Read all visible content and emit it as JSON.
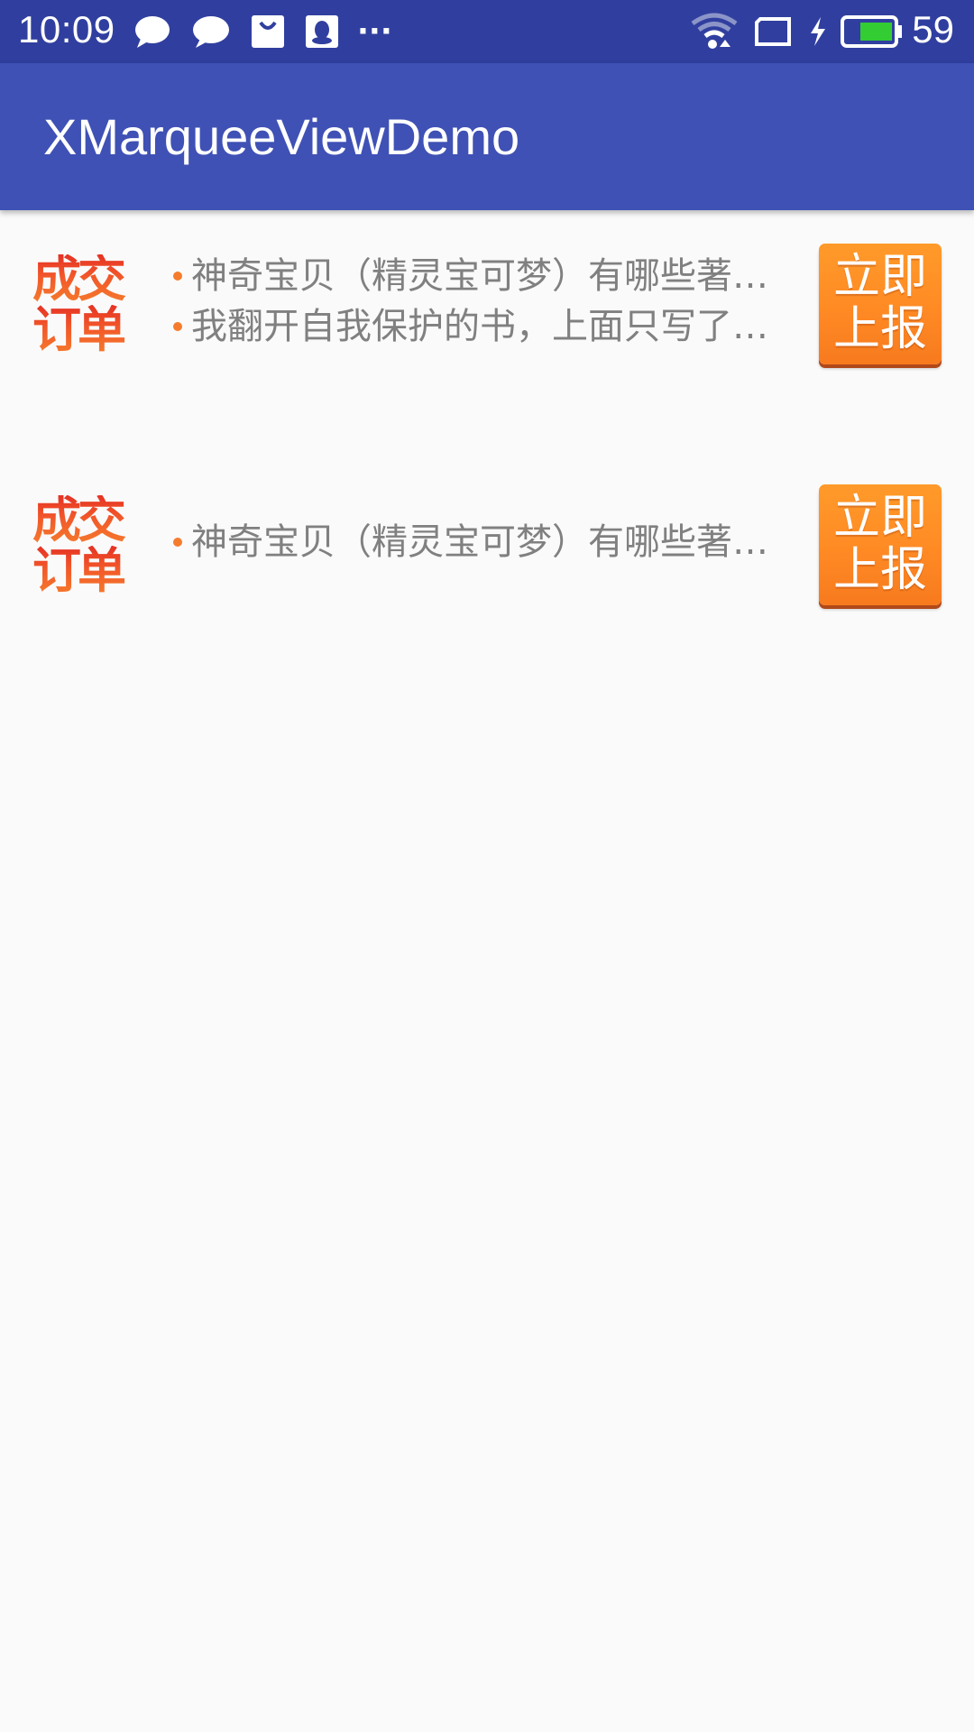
{
  "status_bar": {
    "time": "10:09",
    "battery_level": "59",
    "more_label": "···",
    "icons": [
      "chat-bubble-icon",
      "chat-bubble-icon",
      "shopping-bag-icon",
      "qq-penguin-icon",
      "more-dots-icon",
      "wifi-icon",
      "screen-rotation-icon",
      "charging-bolt-icon",
      "battery-icon"
    ],
    "battery_color": "#33cc33"
  },
  "toolbar": {
    "title": "XMarqueeViewDemo"
  },
  "colors": {
    "status_bar": "#303f9f",
    "toolbar": "#3f51b5",
    "background": "#fafafa",
    "accent_orange": "#ff8a24",
    "logo_red": "#e53224",
    "text_gray": "#808080"
  },
  "rows": [
    {
      "logo_line1": "成交",
      "logo_line2": "订单",
      "items": [
        "神奇宝贝（精灵宝可梦）有哪些著名的台词？",
        "我翻开自我保护的书，上面只写了三个字"
      ],
      "button_line1": "立即",
      "button_line2": "上报"
    },
    {
      "logo_line1": "成交",
      "logo_line2": "订单",
      "items": [
        "神奇宝贝（精灵宝可梦）有哪些著名的台词？"
      ],
      "button_line1": "立即",
      "button_line2": "上报"
    }
  ]
}
